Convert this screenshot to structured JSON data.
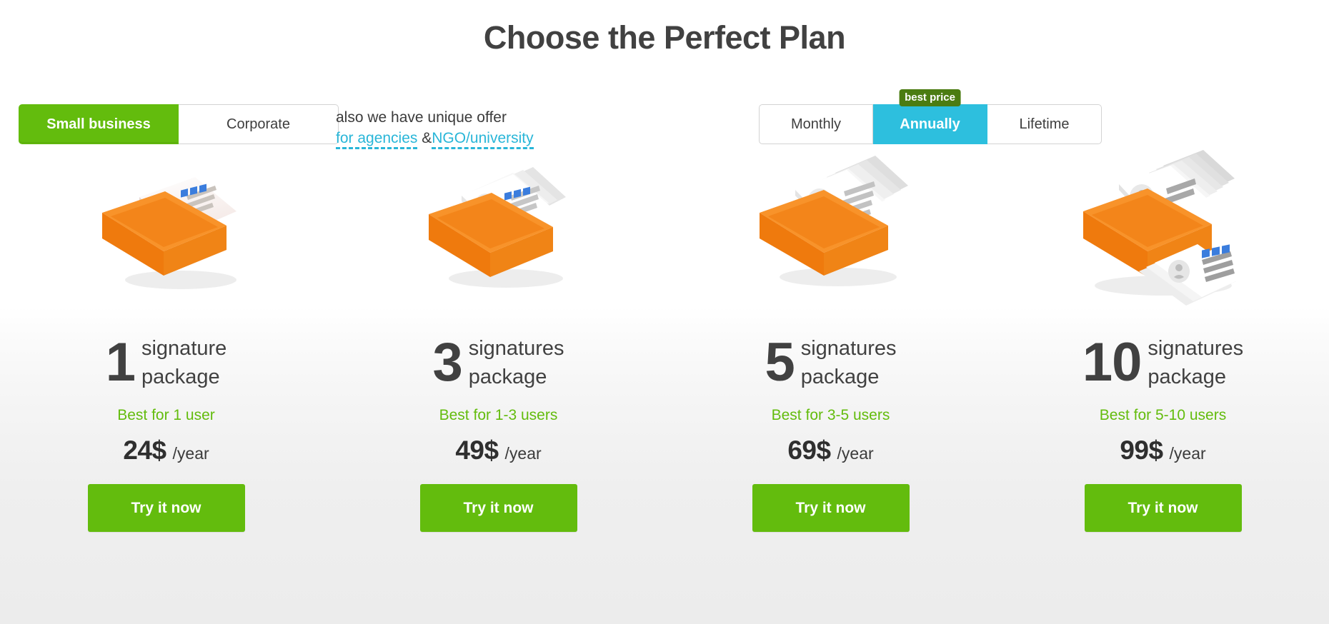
{
  "header": {
    "title": "Choose the Perfect Plan"
  },
  "audience_toggle": {
    "name": "audience",
    "selected": "Small business",
    "options": [
      {
        "label": "Small business",
        "active": true
      },
      {
        "label": "Corporate",
        "active": false
      }
    ]
  },
  "offer_note": {
    "line1": "also we have unique offer",
    "prefix": "",
    "link1": "for agencies",
    "separator": " &",
    "link2": "NGO/university"
  },
  "billing_toggle": {
    "name": "billing-period",
    "selected": "Annually",
    "badge": "best price",
    "options": [
      {
        "label": "Monthly",
        "active": false
      },
      {
        "label": "Annually",
        "active": true
      },
      {
        "label": "Lifetime",
        "active": false
      }
    ]
  },
  "plans": [
    {
      "count": "1",
      "package": "signature\npackage",
      "package_line1": "signature",
      "package_line2": "package",
      "best_for": "Best for 1 user",
      "amount": "24$",
      "period": "/year",
      "cta": "Try it now",
      "art": "card-box-1"
    },
    {
      "count": "3",
      "package_line1": "signatures",
      "package_line2": "package",
      "best_for": "Best for 1-3 users",
      "amount": "49$",
      "period": "/year",
      "cta": "Try it now",
      "art": "card-box-3"
    },
    {
      "count": "5",
      "package_line1": "signatures",
      "package_line2": "package",
      "best_for": "Best for 3-5 users",
      "amount": "69$",
      "period": "/year",
      "cta": "Try it now",
      "art": "card-box-5"
    },
    {
      "count": "10",
      "package_line1": "signatures",
      "package_line2": "package",
      "best_for": "Best for 5-10 users",
      "amount": "99$",
      "period": "/year",
      "cta": "Try it now",
      "art": "card-box-10"
    }
  ],
  "colors": {
    "green": "#63bc0d",
    "cyan": "#2dbfde",
    "badge_green": "#4b7c12",
    "orange": "#f2760c",
    "text_dark": "#414141",
    "link": "#29b6d8"
  }
}
